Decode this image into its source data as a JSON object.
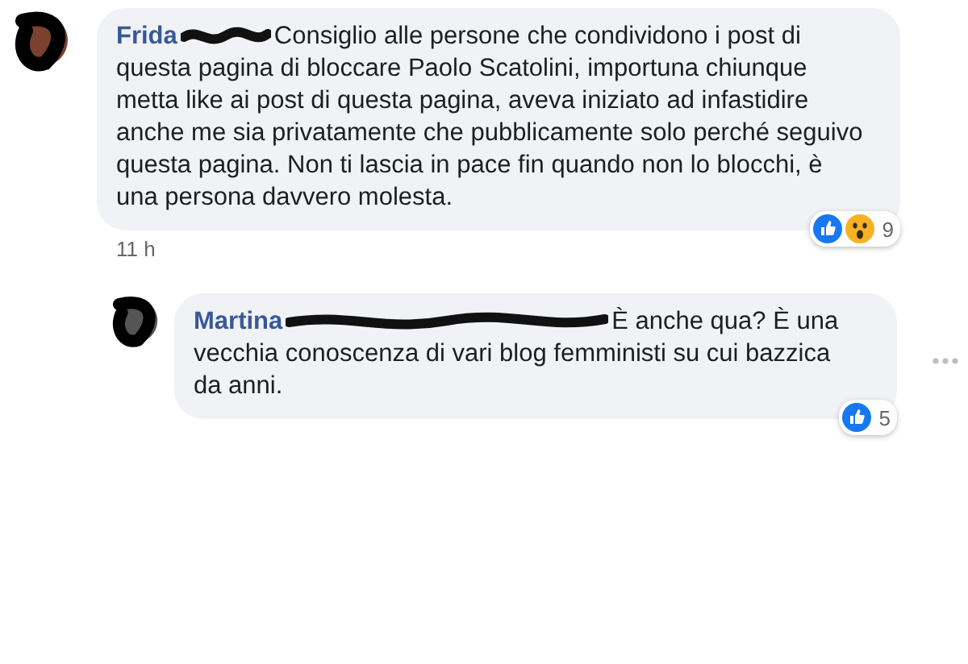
{
  "comments": [
    {
      "author": "Frida",
      "text": "Consiglio alle persone che condividono i post di questa pagina di bloccare Paolo Scatolini, importuna chiunque metta like ai post di questa pagina, aveva iniziato ad infastidire anche me sia privatamente che pubblicamente solo perché seguivo questa pagina. Non ti lascia in pace fin quando non lo blocchi, è una persona davvero molesta.",
      "time": "11 h",
      "reactions": [
        {
          "kind": "like"
        },
        {
          "kind": "wow"
        }
      ],
      "reaction_count": "9",
      "replies": [
        {
          "author": "Martina",
          "text": "È anche qua? È una vecchia conoscenza di vari blog femministi su cui bazzica da anni.",
          "reactions": [
            {
              "kind": "like"
            }
          ],
          "reaction_count": "5"
        }
      ]
    }
  ]
}
